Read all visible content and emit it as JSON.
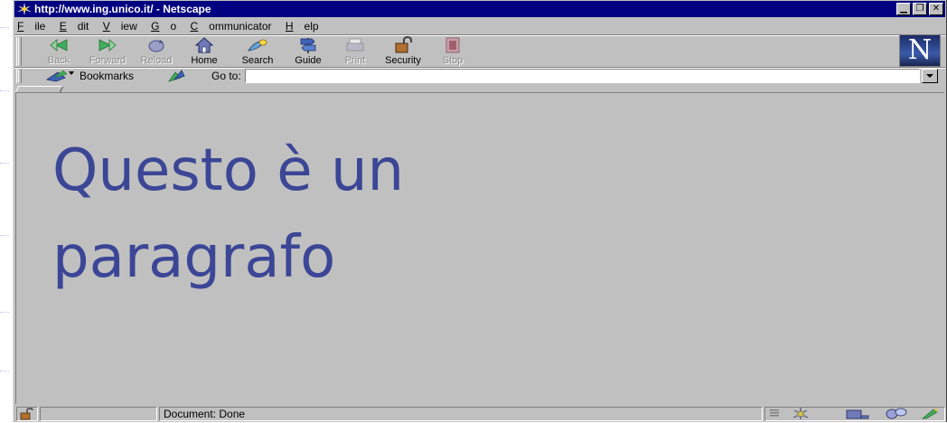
{
  "window": {
    "title": "http://www.ing.unico.it/ - Netscape",
    "controls": [
      "minimize",
      "maximize",
      "close"
    ]
  },
  "menu": [
    {
      "label": "File",
      "key": "F"
    },
    {
      "label": "Edit",
      "key": "E"
    },
    {
      "label": "View",
      "key": "V"
    },
    {
      "label": "Go",
      "key": "G"
    },
    {
      "label": "Communicator",
      "key": "C"
    },
    {
      "label": "Help",
      "key": "H"
    }
  ],
  "toolbar": {
    "back": "Back",
    "forward": "Forward",
    "reload": "Reload",
    "home": "Home",
    "search": "Search",
    "guide": "Guide",
    "print": "Print",
    "security": "Security",
    "stop": "Stop"
  },
  "location": {
    "bookmarks_label": "Bookmarks",
    "goto_label": "Go to:",
    "url": ""
  },
  "content": {
    "paragraph": "Questo è un paragrafo"
  },
  "status": {
    "text": "Document: Done"
  },
  "colors": {
    "title_bar": "#000080",
    "chrome": "#c0c0c0",
    "paragraph_text": "#3c4696"
  },
  "icons": {
    "logo": "netscape-n-logo",
    "app": "netscape-app-icon"
  }
}
